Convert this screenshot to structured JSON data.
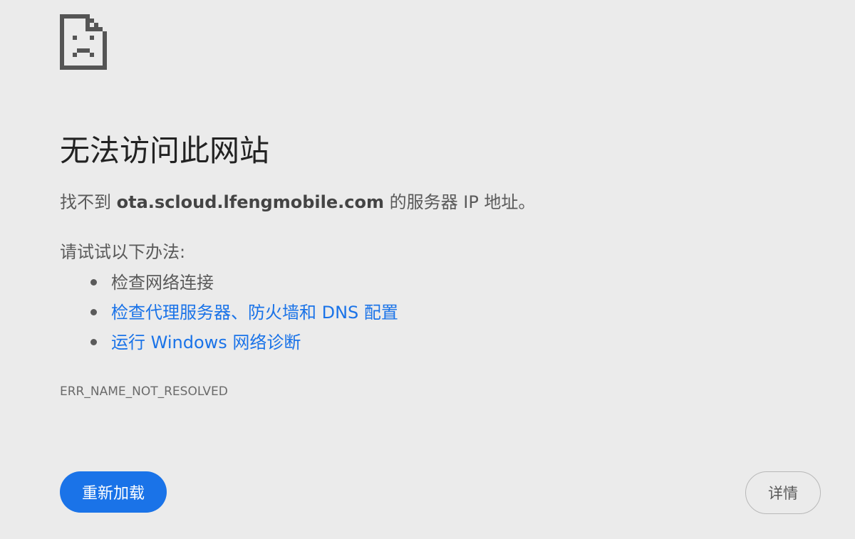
{
  "icon": "sad-page-icon",
  "title": "无法访问此网站",
  "message": {
    "prefix": "找不到 ",
    "host": "ota.scloud.lfengmobile.com",
    "suffix": " 的服务器 IP 地址。"
  },
  "suggestions": {
    "intro": "请试试以下办法:",
    "items": [
      {
        "text": "检查网络连接",
        "is_link": false
      },
      {
        "text": "检查代理服务器、防火墙和 DNS 配置",
        "is_link": true
      },
      {
        "text": "运行 Windows 网络诊断",
        "is_link": true
      }
    ]
  },
  "error_code": "ERR_NAME_NOT_RESOLVED",
  "buttons": {
    "reload_label": "重新加载",
    "details_label": "详情"
  },
  "colors": {
    "background": "#ebebeb",
    "link": "#1a73e8",
    "primary_button": "#1a73e8",
    "text": "#5a5a5a"
  }
}
